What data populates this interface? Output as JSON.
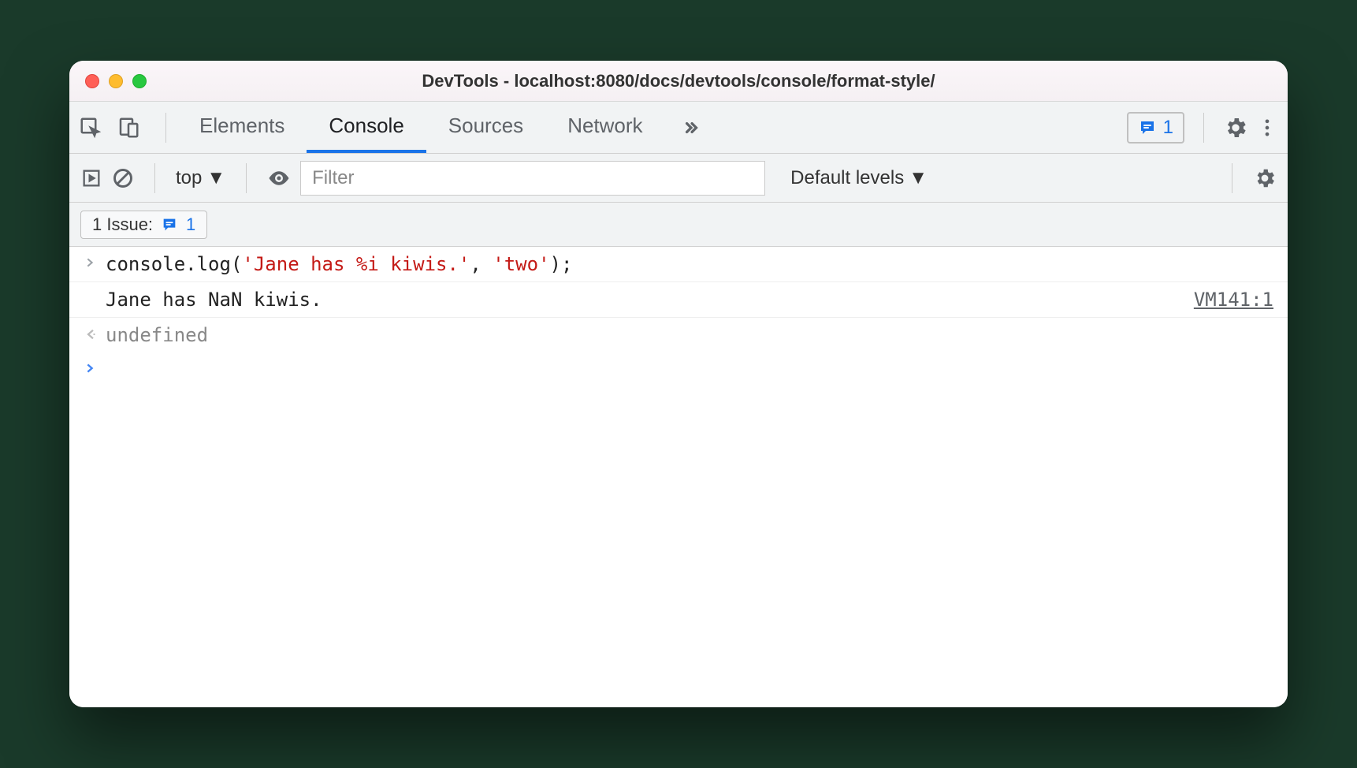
{
  "window": {
    "title": "DevTools - localhost:8080/docs/devtools/console/format-style/"
  },
  "tabs": {
    "elements": "Elements",
    "console": "Console",
    "sources": "Sources",
    "network": "Network"
  },
  "issues_badge": {
    "count": "1"
  },
  "toolbar": {
    "context": "top",
    "filter_placeholder": "Filter",
    "levels": "Default levels"
  },
  "issuebar": {
    "label": "1 Issue:",
    "count": "1"
  },
  "console": {
    "input_line": {
      "pre": "console.log(",
      "str1": "'Jane has %i kiwis.'",
      "sep": ", ",
      "str2": "'two'",
      "post": ");"
    },
    "output_line": "Jane has NaN kiwis.",
    "source_ref": "VM141:1",
    "return_line": "undefined"
  }
}
